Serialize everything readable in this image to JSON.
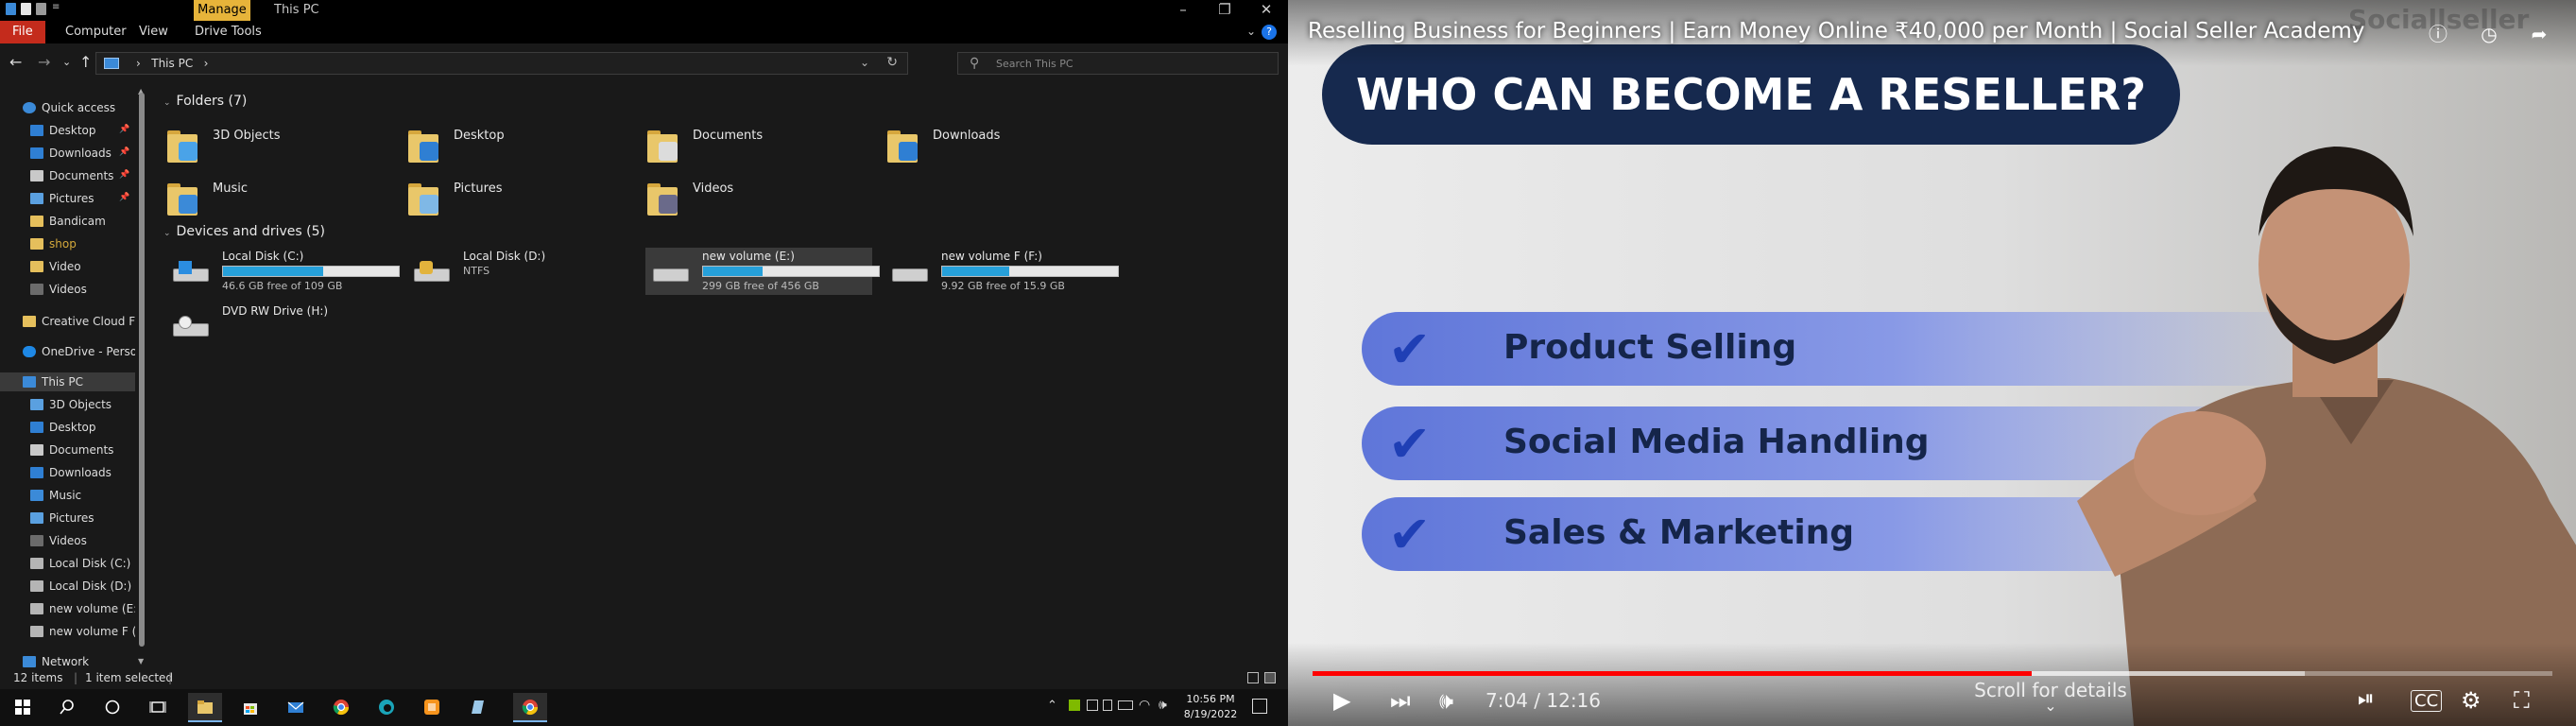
{
  "explorer": {
    "window_title": "This PC",
    "context_tab": "Manage",
    "ribbon_tabs": [
      "File",
      "Computer",
      "View",
      "Drive Tools"
    ],
    "address": "This PC",
    "search_placeholder": "Search This PC",
    "nav": {
      "quick_access": "Quick access",
      "pinned": [
        "Desktop",
        "Downloads",
        "Documents",
        "Pictures"
      ],
      "recent": [
        "Bandicam",
        "shop",
        "Video",
        "Videos"
      ],
      "creative_cloud": "Creative Cloud Fil",
      "onedrive": "OneDrive - Person",
      "this_pc": "This PC",
      "this_pc_items": [
        "3D Objects",
        "Desktop",
        "Documents",
        "Downloads",
        "Music",
        "Pictures",
        "Videos",
        "Local Disk (C:)",
        "Local Disk (D:)",
        "new volume (E:)",
        "new volume F (F"
      ],
      "network": "Network"
    },
    "folders_header": "Folders (7)",
    "folders": [
      "3D Objects",
      "Desktop",
      "Documents",
      "Downloads",
      "Music",
      "Pictures",
      "Videos"
    ],
    "devices_header": "Devices and drives (5)",
    "drives": [
      {
        "name": "Local Disk (C:)",
        "detail": "46.6 GB free of 109 GB",
        "used_fraction": 0.57
      },
      {
        "name": "Local Disk (D:)",
        "detail": "NTFS"
      },
      {
        "name": "new volume (E:)",
        "detail": "299 GB free of 456 GB",
        "used_fraction": 0.34
      },
      {
        "name": "new volume F (F:)",
        "detail": "9.92 GB free of 15.9 GB",
        "used_fraction": 0.38
      },
      {
        "name": "DVD RW Drive (H:)",
        "detail": ""
      }
    ],
    "status": {
      "items": "12 items",
      "selected": "1 item selected"
    }
  },
  "taskbar": {
    "time": "10:56 PM",
    "date": "8/19/2022"
  },
  "video": {
    "title": "Reselling Business for Beginners | Earn Money Online ₹40,000 per Month | Social Seller Academy",
    "headline": "WHO CAN BECOME A RESELLER?",
    "points": [
      "Product Selling",
      "Social Media Handling",
      "Sales & Marketing"
    ],
    "brand_watermark": "Sociallseller",
    "time": "7:04 / 12:16",
    "progress_fraction": 0.58,
    "buffered_fraction": 0.8,
    "scroll_hint": "Scroll for details",
    "accent_color": "#ff0000"
  }
}
